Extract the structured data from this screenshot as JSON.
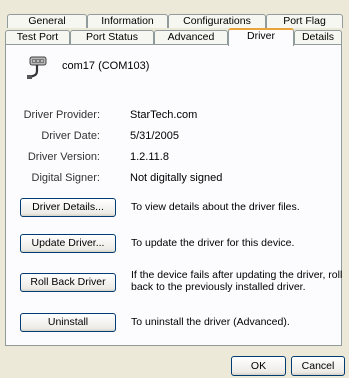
{
  "tabs_back": [
    "General",
    "Information",
    "Configurations",
    "Port Flag"
  ],
  "tabs_front": [
    "Test Port",
    "Port Status",
    "Advanced",
    "Driver",
    "Details"
  ],
  "active_tab": "Driver",
  "device": {
    "name": "com17 (COM103)",
    "icon": "serial-port-icon"
  },
  "info": {
    "provider_label": "Driver Provider:",
    "provider_value": "StarTech.com",
    "date_label": "Driver Date:",
    "date_value": "5/31/2005",
    "version_label": "Driver Version:",
    "version_value": "1.2.11.8",
    "signer_label": "Digital Signer:",
    "signer_value": "Not digitally signed"
  },
  "actions": {
    "details_label": "Driver Details...",
    "details_desc": "To view details about the driver files.",
    "update_label": "Update Driver...",
    "update_desc": "To update the driver for this device.",
    "rollback_label": "Roll Back Driver",
    "rollback_desc_1": "If the device fails after updating the driver, roll",
    "rollback_desc_2": "back to the previously installed driver.",
    "uninstall_label": "Uninstall",
    "uninstall_desc": "To uninstall the driver (Advanced)."
  },
  "footer": {
    "ok_label": "OK",
    "cancel_label": "Cancel"
  },
  "colors": {
    "dialog_bg": "#ece9d8",
    "panel_bg": "#fcfcfe",
    "active_tab_accent": "#e8a33c",
    "button_border": "#003c74"
  }
}
